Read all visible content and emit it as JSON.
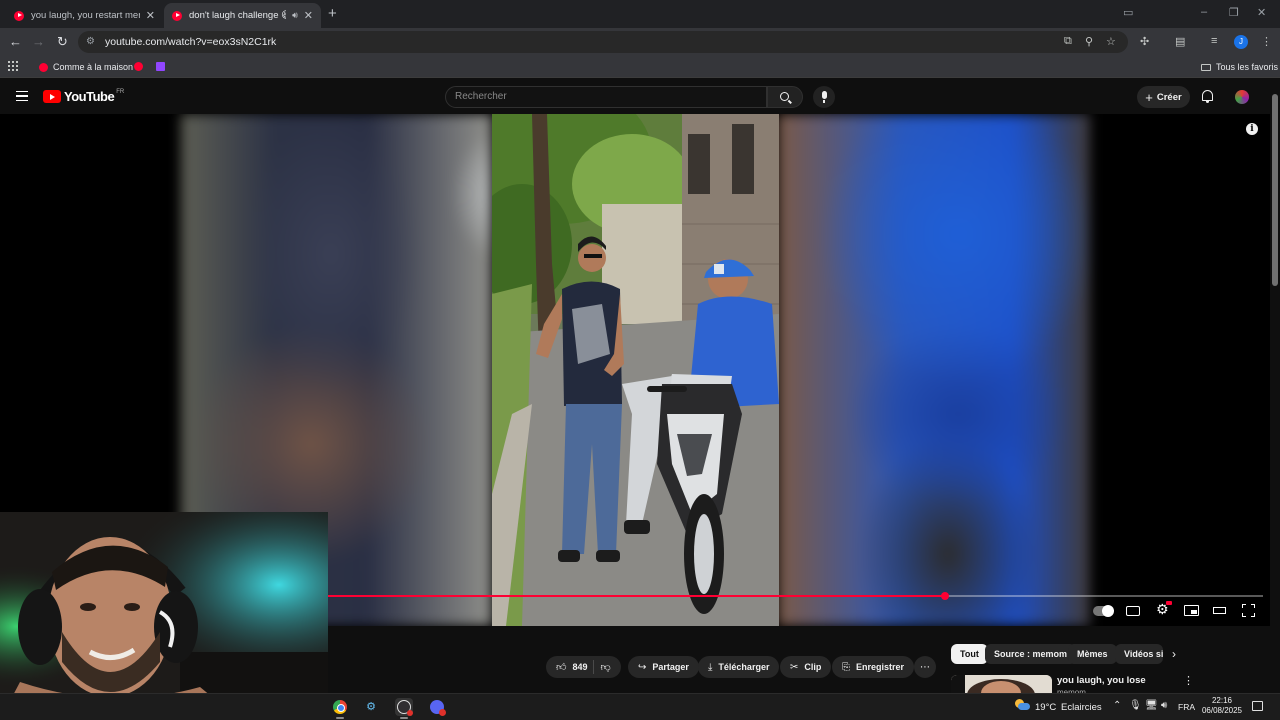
{
  "browser": {
    "tabs": [
      {
        "title": "you laugh, you restart meme -"
      },
      {
        "title": "don't laugh challenge 😆"
      }
    ],
    "url": "youtube.com/watch?v=eox3sN2C1rk",
    "bookmarks": [
      {
        "label": "Comme à la maison"
      }
    ],
    "all_bookmarks_label": "Tous les favoris",
    "profile_initial": "J"
  },
  "youtube": {
    "logo_text": "YouTube",
    "country_code": "FR",
    "search_placeholder": "Rechercher",
    "create_label": "Créer",
    "player": {
      "progress": 0.66,
      "accent_color": "#ff0033"
    },
    "actions": {
      "likes": "849",
      "share": "Partager",
      "download": "Télécharger",
      "clip": "Clip",
      "save": "Enregistrer"
    },
    "filters": [
      {
        "label": "Tout",
        "active": true
      },
      {
        "label": "Source : memom",
        "active": false
      },
      {
        "label": "Mèmes",
        "active": false
      },
      {
        "label": "Vidéos si",
        "active": false
      }
    ],
    "recommendation": {
      "title": "you laugh, you lose",
      "channel": "memom"
    }
  },
  "taskbar": {
    "temperature": "19°C",
    "weather": "Eclaircies",
    "language": "FRA",
    "time": "22:16",
    "date": "06/08/2025"
  }
}
